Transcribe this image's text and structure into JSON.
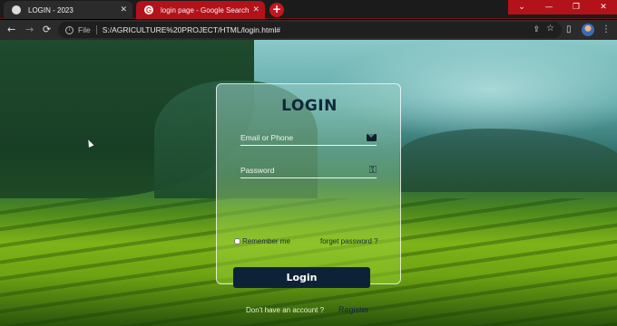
{
  "browser": {
    "tabs": [
      {
        "title": "LOGIN - 2023",
        "active": false
      },
      {
        "title": "login page - Google Search",
        "active": true
      }
    ],
    "new_tab_glyph": "+",
    "window_controls": [
      "⌄",
      "—",
      "❐",
      "✕"
    ],
    "address": {
      "scheme_label": "File",
      "url": "S:/AGRICULTURE%20PROJECT/HTML/login.html#"
    }
  },
  "login_form": {
    "title": "LOGIN",
    "email_placeholder": "Email or Phone",
    "password_placeholder": "Password",
    "remember_label": "Remember me",
    "remember_checked": false,
    "forgot_label": "forget password ?",
    "submit_label": "Login",
    "signup_prompt": "Don't have an account ?",
    "register_label": "Register"
  },
  "colors": {
    "browser_accent": "#b3121a",
    "button_bg": "#0d2236",
    "title_text": "#10283a"
  },
  "icons": [
    "globe-icon",
    "google-icon",
    "close-icon",
    "back-icon",
    "forward-icon",
    "reload-icon",
    "info-icon",
    "share-icon",
    "star-icon",
    "sidebar-icon",
    "mail-icon",
    "key-icon"
  ]
}
